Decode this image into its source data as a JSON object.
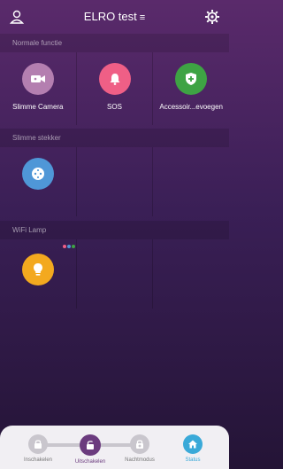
{
  "header": {
    "title": "ELRO test",
    "menu_glyph": "≡",
    "left_icon": "person-icon",
    "right_icon": "gear-icon"
  },
  "sections": [
    {
      "title": "Normale functie",
      "tiles": [
        {
          "label": "Slimme Camera",
          "icon": "camera-icon",
          "color": "#b47fb0"
        },
        {
          "label": "SOS",
          "icon": "bell-icon",
          "color": "#ef5f86"
        },
        {
          "label": "Accessoir...evoegen",
          "icon": "shield-plus-icon",
          "color": "#3ea344"
        }
      ]
    },
    {
      "title": "Slimme stekker",
      "tiles": [
        {
          "label": "",
          "icon": "plug-socket-icon",
          "color": "#4f97d7"
        }
      ]
    },
    {
      "title": "WiFi Lamp",
      "tiles": [
        {
          "label": "",
          "icon": "lamp-icon",
          "color": "#f3a91f",
          "dot_colors": [
            "#ef5f86",
            "#4f97d7",
            "#3ea344"
          ]
        }
      ]
    }
  ],
  "bottom_nav": [
    {
      "label": "Inschakelen",
      "icon": "lock-icon",
      "state": "inactive"
    },
    {
      "label": "Uitschakelen",
      "icon": "unlock-icon",
      "state": "active"
    },
    {
      "label": "Nachtmodus",
      "icon": "night-lock-icon",
      "state": "inactive"
    },
    {
      "label": "Status",
      "icon": "home-icon",
      "state": "status"
    }
  ]
}
